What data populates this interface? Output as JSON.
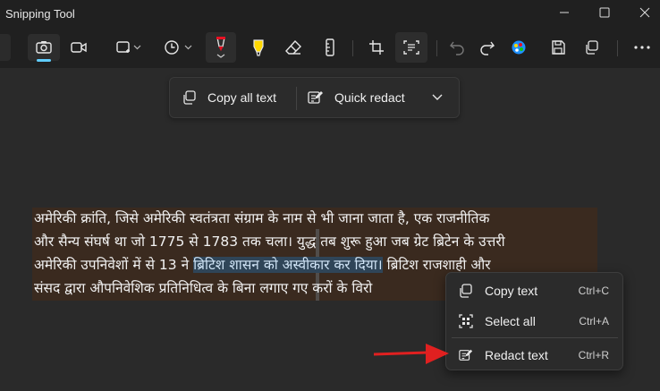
{
  "window": {
    "title": "Snipping Tool",
    "controls": [
      "minimize-icon",
      "maximize-icon",
      "close-icon"
    ]
  },
  "toolbar": {
    "tools": [
      "camera-icon",
      "video-icon",
      "snip-mode-icon",
      "timer-icon",
      "pen-icon",
      "highlighter-icon",
      "eraser-icon",
      "ruler-icon",
      "crop-icon",
      "text-actions-icon",
      "undo-icon",
      "redo-icon",
      "paint-icon",
      "save-icon",
      "copy-icon",
      "more-icon"
    ]
  },
  "text_actions": {
    "copy_all": "Copy all text",
    "quick_redact": "Quick redact"
  },
  "snip_text": {
    "line1": "अमेरिकी क्रांति, जिसे अमेरिकी स्वतंत्रता संग्राम के नाम से भी जाना जाता है, एक राजनीतिक",
    "line2": "और सैन्य संघर्ष था जो 1775 से 1783 तक चला। युद्ध तब शुरू हुआ जब ग्रेट ब्रिटेन के उत्तरी",
    "line3_a": "अमेरिकी उपनिवेशों में से 13 ने ",
    "line3_selected": "ब्रिटिश शासन को अस्वीकार कर दिया।",
    "line3_b": " ब्रिटिश राजशाही और",
    "line4": "संसद द्वारा औपनिवेशिक प्रतिनिधित्व के बिना लगाए गए करों के विरो"
  },
  "context_menu": {
    "items": [
      {
        "label": "Copy text",
        "shortcut": "Ctrl+C",
        "icon": "copy-icon"
      },
      {
        "label": "Select all",
        "shortcut": "Ctrl+A",
        "icon": "select-all-icon"
      },
      {
        "label": "Redact text",
        "shortcut": "Ctrl+R",
        "icon": "redact-icon"
      }
    ]
  },
  "colors": {
    "background": "#202020",
    "canvas": "#2a2a2a",
    "accent": "#60cdff",
    "annotation_arrow": "#e02020",
    "selection": "#2f4558"
  }
}
